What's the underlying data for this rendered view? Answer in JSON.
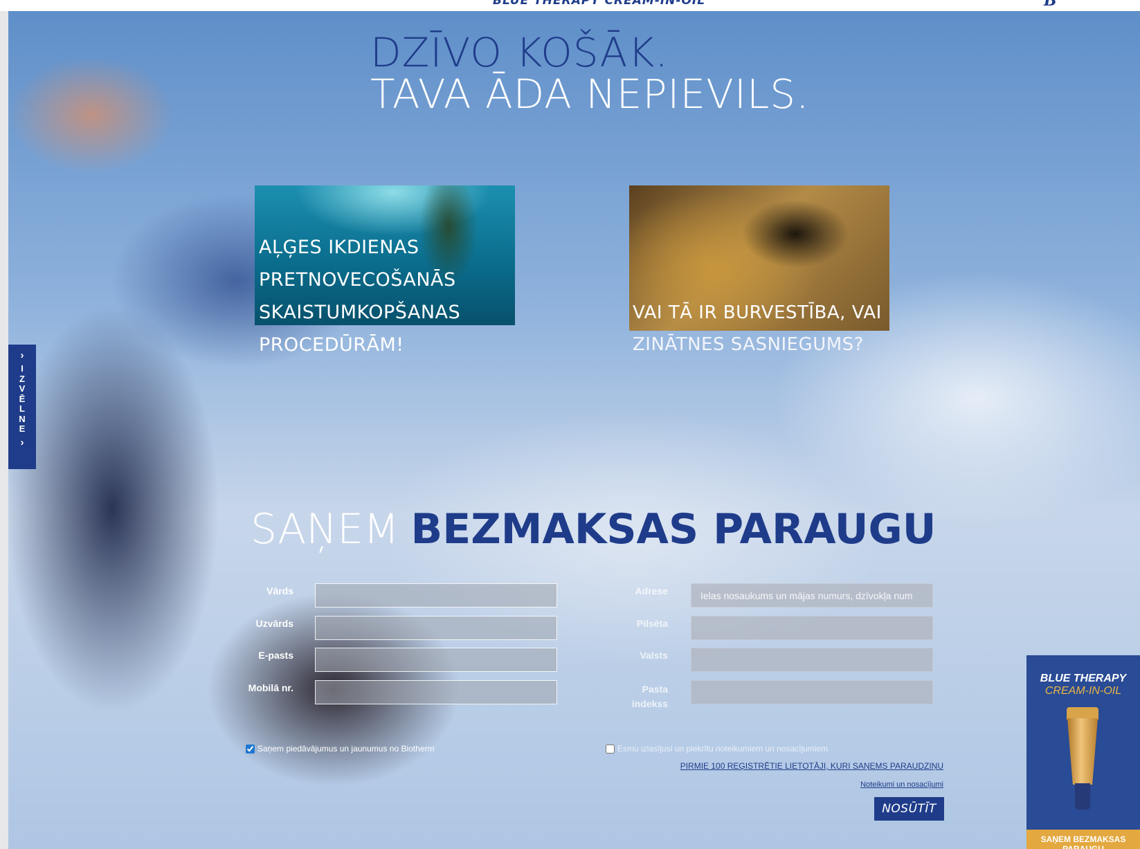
{
  "top_bar": {
    "strip_text": "BLUE THERAPY CREAM-IN-OIL",
    "logo_text": "B"
  },
  "headline": {
    "line1": "DZĪVO KOŠĀK.",
    "line2": "TAVA ĀDA NEPIEVILS."
  },
  "promos": [
    {
      "lines": [
        "AĻĢES IKDIENAS",
        "PRETNOVECOŠANĀS",
        "SKAISTUMKOPŠANAS",
        "PROCEDŪRĀM!"
      ]
    },
    {
      "lines": [
        "VAI TĀ IR BURVESTĪBA, VAI",
        "ZINĀTNES SASNIEGUMS?"
      ]
    }
  ],
  "side_menu": {
    "label": "IZVĒLNE",
    "chevron": "›"
  },
  "form": {
    "title_light": "SAŅEM",
    "title_bold": "BEZMAKSAS PARAUGU",
    "fields_left": [
      {
        "label": "Vārds",
        "value": ""
      },
      {
        "label": "Uzvārds",
        "value": ""
      },
      {
        "label": "E-pasts",
        "value": ""
      },
      {
        "label": "Mobilā nr.",
        "value": ""
      }
    ],
    "fields_right": [
      {
        "label": "Adrese",
        "placeholder": "Ielas nosaukums un mājas numurs, dzīvokļa num"
      },
      {
        "label": "Pilsēta",
        "value": ""
      },
      {
        "label": "Valsts",
        "value": ""
      },
      {
        "label": "Pasta indekss",
        "value": ""
      }
    ],
    "newsletter_checkbox": {
      "label": "Saņem piedāvājumus un jaunumus no Biotherm",
      "checked": true
    },
    "terms_checkbox": {
      "label": "Esmu izlasījusi un piekrītu noteikumiem un nosacījumiem",
      "checked": false
    },
    "promo_link": "PIRMIE 100 REĢISTRĒTIE LIETOTĀJI, KURI SAŅEMS PARAUDZIŅU",
    "terms_link": "Noteikumi un nosacījumi",
    "submit_label": "NOSŪTĪT"
  },
  "product_ad": {
    "brand": "BLUE THERAPY",
    "product": "CREAM-IN-OIL",
    "cta": "SAŅEM BEZMAKSAS PARAUGU"
  },
  "colors": {
    "brand_blue": "#1f3c8a",
    "ad_blue": "#2a4b95",
    "ad_gold": "#e3a83f"
  }
}
